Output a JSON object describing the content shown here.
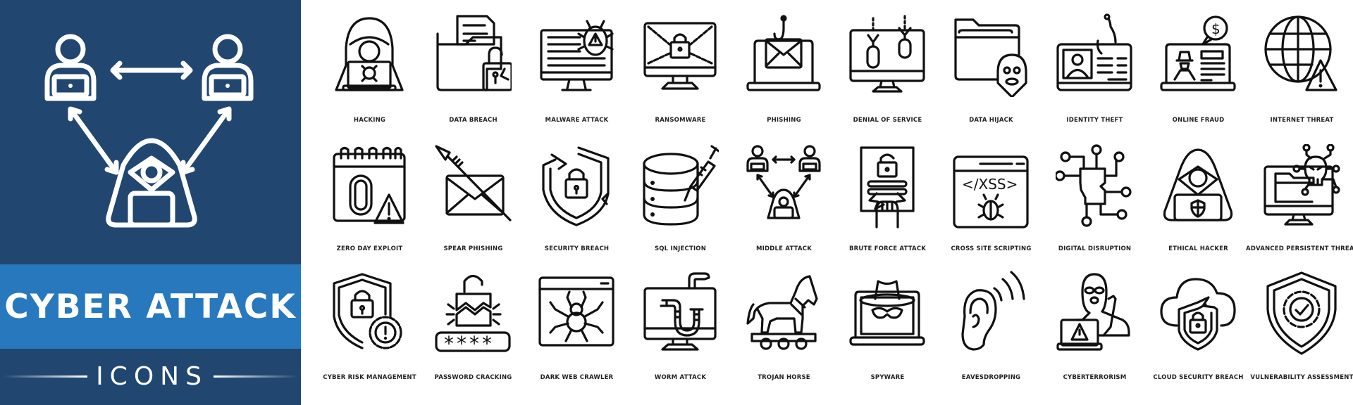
{
  "banner": {
    "title": "CYBER ATTACK",
    "subtitle": "ICONS",
    "colors": {
      "panel": "#21466f",
      "band": "#2878be",
      "text": "#ffffff",
      "icon_stroke": "#111111"
    },
    "hero_icon": "middle-attack-icon"
  },
  "icons": [
    {
      "label": "HACKING",
      "icon": "hacker-laptop-icon"
    },
    {
      "label": "DATA BREACH",
      "icon": "folder-unlocked-icon"
    },
    {
      "label": "MALWARE ATTACK",
      "icon": "monitor-bug-icon"
    },
    {
      "label": "RANSOMWARE",
      "icon": "monitor-chains-lock-icon"
    },
    {
      "label": "PHISHING",
      "icon": "laptop-email-hook-icon"
    },
    {
      "label": "DENIAL OF SERVICE",
      "icon": "monitor-bombs-icon"
    },
    {
      "label": "DATA HIJACK",
      "icon": "folder-mask-icon"
    },
    {
      "label": "IDENTITY THEFT",
      "icon": "id-card-hook-icon"
    },
    {
      "label": "ONLINE FRAUD",
      "icon": "laptop-spy-dollar-icon"
    },
    {
      "label": "INTERNET THREAT",
      "icon": "globe-warning-icon"
    },
    {
      "label": "ZERO DAY EXPLOIT",
      "icon": "calendar-zero-warning-icon"
    },
    {
      "label": "SPEAR PHISHING",
      "icon": "spear-envelope-icon"
    },
    {
      "label": "SECURITY BREACH",
      "icon": "broken-shield-lock-icon"
    },
    {
      "label": "SQL INJECTION",
      "icon": "database-syringe-icon"
    },
    {
      "label": "MIDDLE ATTACK",
      "icon": "man-in-the-middle-icon"
    },
    {
      "label": "BRUTE FORCE ATTACK",
      "icon": "fist-lock-icon"
    },
    {
      "label": "CROSS SITE SCRIPTING",
      "icon": "browser-xss-bug-icon",
      "code_text": "</XSS>"
    },
    {
      "label": "DIGITAL DISRUPTION",
      "icon": "broken-circuit-icon"
    },
    {
      "label": "ETHICAL HACKER",
      "icon": "hacker-shield-laptop-icon"
    },
    {
      "label": "ADVANCED PERSISTENT THREAT",
      "icon": "monitor-folder-skull-icon"
    },
    {
      "label": "CYBER RISK MANAGEMENT",
      "icon": "shield-lock-gear-icon"
    },
    {
      "label": "PASSWORD CRACKING",
      "icon": "broken-lock-password-icon",
      "password_text": "****"
    },
    {
      "label": "DARK WEB CRAWLER",
      "icon": "browser-spider-icon"
    },
    {
      "label": "WORM ATTACK",
      "icon": "monitor-worm-icon"
    },
    {
      "label": "TROJAN HORSE",
      "icon": "trojan-horse-icon"
    },
    {
      "label": "SPYWARE",
      "icon": "laptop-spy-hat-icon"
    },
    {
      "label": "EAVESDROPPING",
      "icon": "ear-signal-icon"
    },
    {
      "label": "CYBERTERRORISM",
      "icon": "masked-terrorist-laptop-icon"
    },
    {
      "label": "CLOUD SECURITY BREACH",
      "icon": "cloud-broken-shield-icon"
    },
    {
      "label": "VULNERABILITY ASSESSMENT",
      "icon": "shield-gear-check-icon"
    }
  ]
}
